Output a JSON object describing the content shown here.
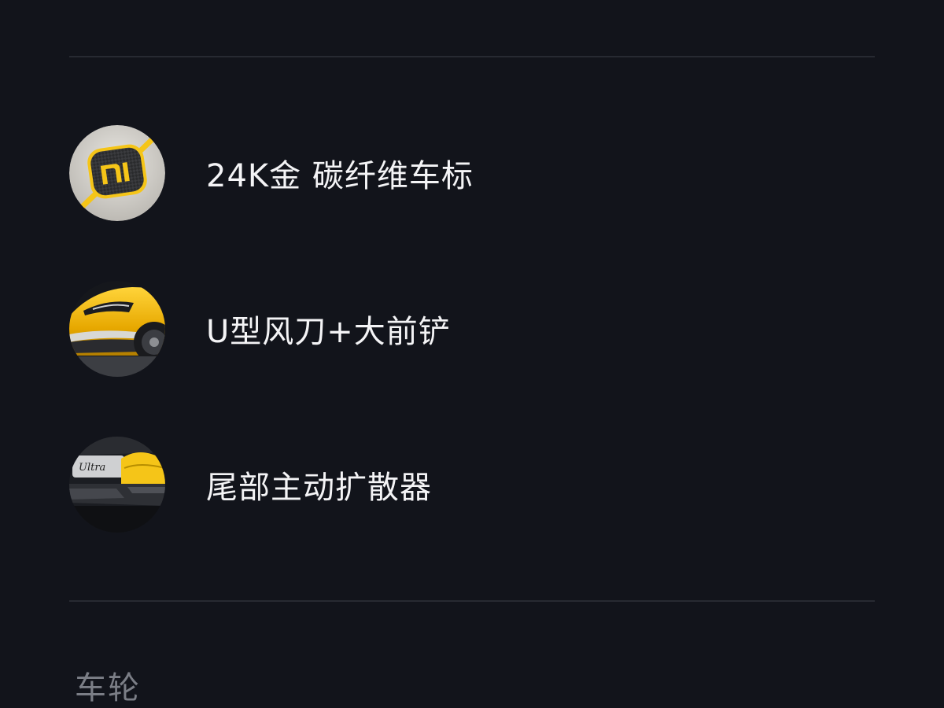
{
  "features": {
    "items": [
      {
        "label": "24K金 碳纤维车标",
        "icon": "xiaomi-badge-icon"
      },
      {
        "label": "U型风刀+大前铲",
        "icon": "front-splitter-icon"
      },
      {
        "label": "尾部主动扩散器",
        "icon": "rear-diffuser-icon"
      }
    ]
  },
  "section": {
    "title": "车轮"
  },
  "colors": {
    "background": "#12141b",
    "divider": "#272a32",
    "accent_gold": "#f5c518",
    "section_title": "#7b7e86"
  }
}
